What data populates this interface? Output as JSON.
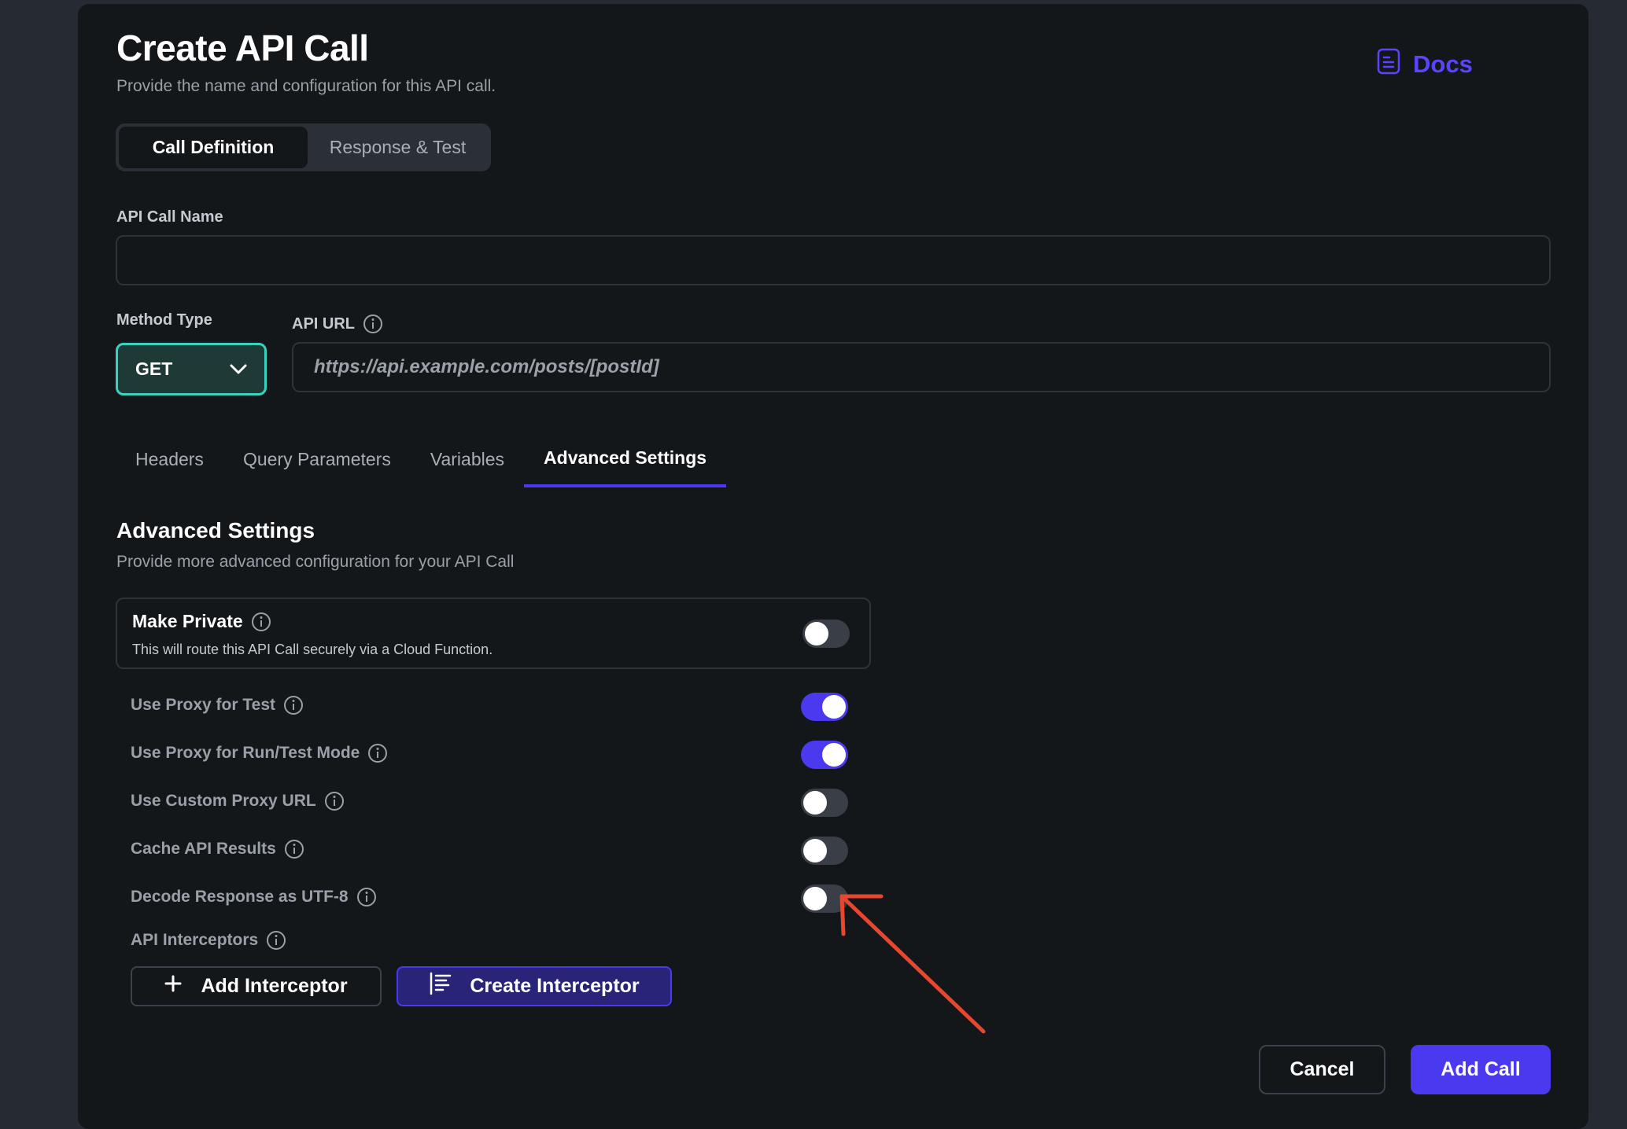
{
  "header": {
    "title": "Create API Call",
    "subtitle": "Provide the name and configuration for this API call.",
    "docs_label": "Docs"
  },
  "segment": {
    "active": "Call Definition",
    "inactive": "Response & Test"
  },
  "form": {
    "name_label": "API Call Name",
    "name_value": "",
    "method_label": "Method Type",
    "method_value": "GET",
    "url_label": "API URL",
    "url_placeholder": "https://api.example.com/posts/[postId]"
  },
  "tabs": [
    {
      "label": "Headers",
      "active": false
    },
    {
      "label": "Query Parameters",
      "active": false
    },
    {
      "label": "Variables",
      "active": false
    },
    {
      "label": "Advanced Settings",
      "active": true
    }
  ],
  "advanced": {
    "title": "Advanced Settings",
    "subtitle": "Provide more advanced configuration for your API Call",
    "make_private": {
      "label": "Make Private",
      "description": "This will route this API Call securely via a Cloud Function.",
      "enabled": false
    },
    "settings": [
      {
        "label": "Use Proxy for Test",
        "enabled": true
      },
      {
        "label": "Use Proxy for Run/Test Mode",
        "enabled": true
      },
      {
        "label": "Use Custom Proxy URL",
        "enabled": false
      },
      {
        "label": "Cache API Results",
        "enabled": false
      },
      {
        "label": "Decode Response as UTF-8",
        "enabled": false
      }
    ],
    "interceptors_label": "API Interceptors",
    "add_interceptor_label": "Add Interceptor",
    "create_interceptor_label": "Create Interceptor"
  },
  "footer": {
    "cancel_label": "Cancel",
    "add_call_label": "Add Call"
  },
  "colors": {
    "accent": "#4b39ef",
    "teal": "#39d2c0",
    "annotation_arrow": "#e8472f",
    "background": "#14171a"
  }
}
